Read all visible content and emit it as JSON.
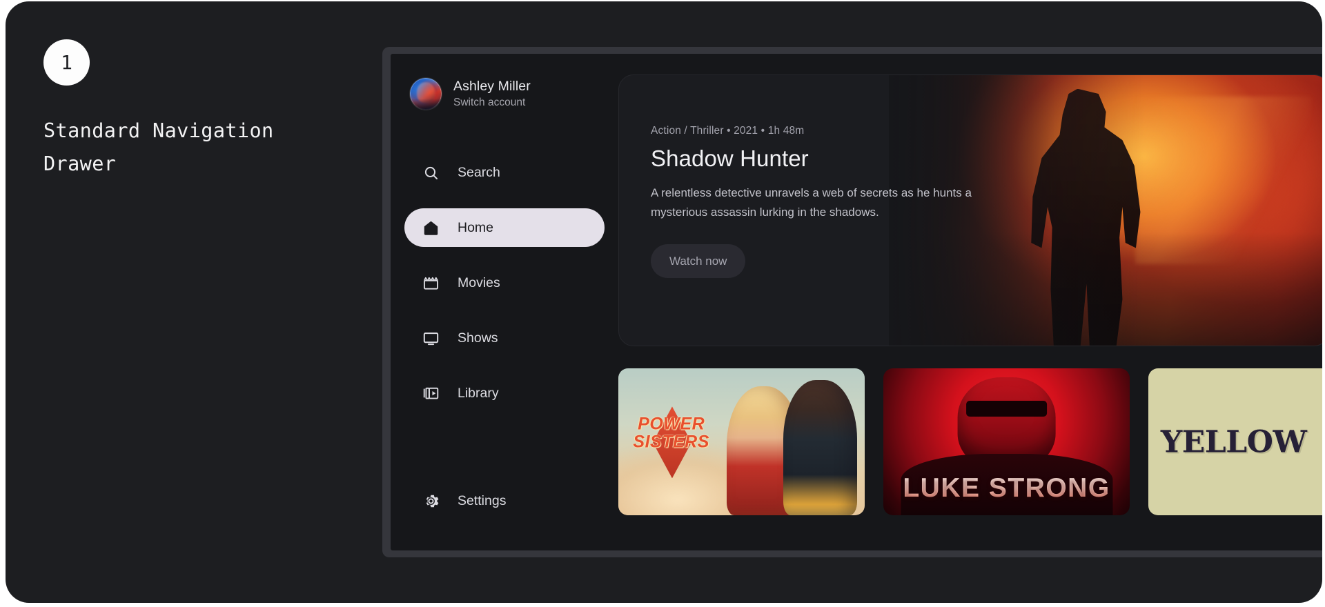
{
  "annotation": {
    "step_number": "1",
    "title": "Standard Navigation\nDrawer"
  },
  "drawer": {
    "account": {
      "name": "Ashley Miller",
      "action": "Switch account",
      "avatar_icon": "user-avatar-photo"
    },
    "items": [
      {
        "label": "Search",
        "icon": "search-icon",
        "selected": false
      },
      {
        "label": "Home",
        "icon": "home-icon",
        "selected": true
      },
      {
        "label": "Movies",
        "icon": "movie-icon",
        "selected": false
      },
      {
        "label": "Shows",
        "icon": "tv-icon",
        "selected": false
      },
      {
        "label": "Library",
        "icon": "library-icon",
        "selected": false
      }
    ],
    "settings": {
      "label": "Settings",
      "icon": "gear-icon"
    },
    "selected_color": "#e4e0e9"
  },
  "hero": {
    "meta": "Action / Thriller • 2021 • 1h 48m",
    "title": "Shadow Hunter",
    "description": "A relentless detective unravels a web of secrets as he hunts a mysterious assassin lurking in the shadows.",
    "cta_label": "Watch now",
    "artwork_alt": "hero-superhero-artwork"
  },
  "rail": {
    "cards": [
      {
        "title": "POWER SISTERS",
        "line1": "POWER",
        "line2": "SISTERS",
        "artwork_alt": "power-sisters-poster",
        "accent": "#e8502e"
      },
      {
        "title": "LUKE STRONG",
        "artwork_alt": "luke-strong-poster",
        "accent": "#f2222c"
      },
      {
        "title": "YELLOW",
        "artwork_alt": "yellow-poster",
        "accent": "#d6d3a6"
      }
    ]
  }
}
